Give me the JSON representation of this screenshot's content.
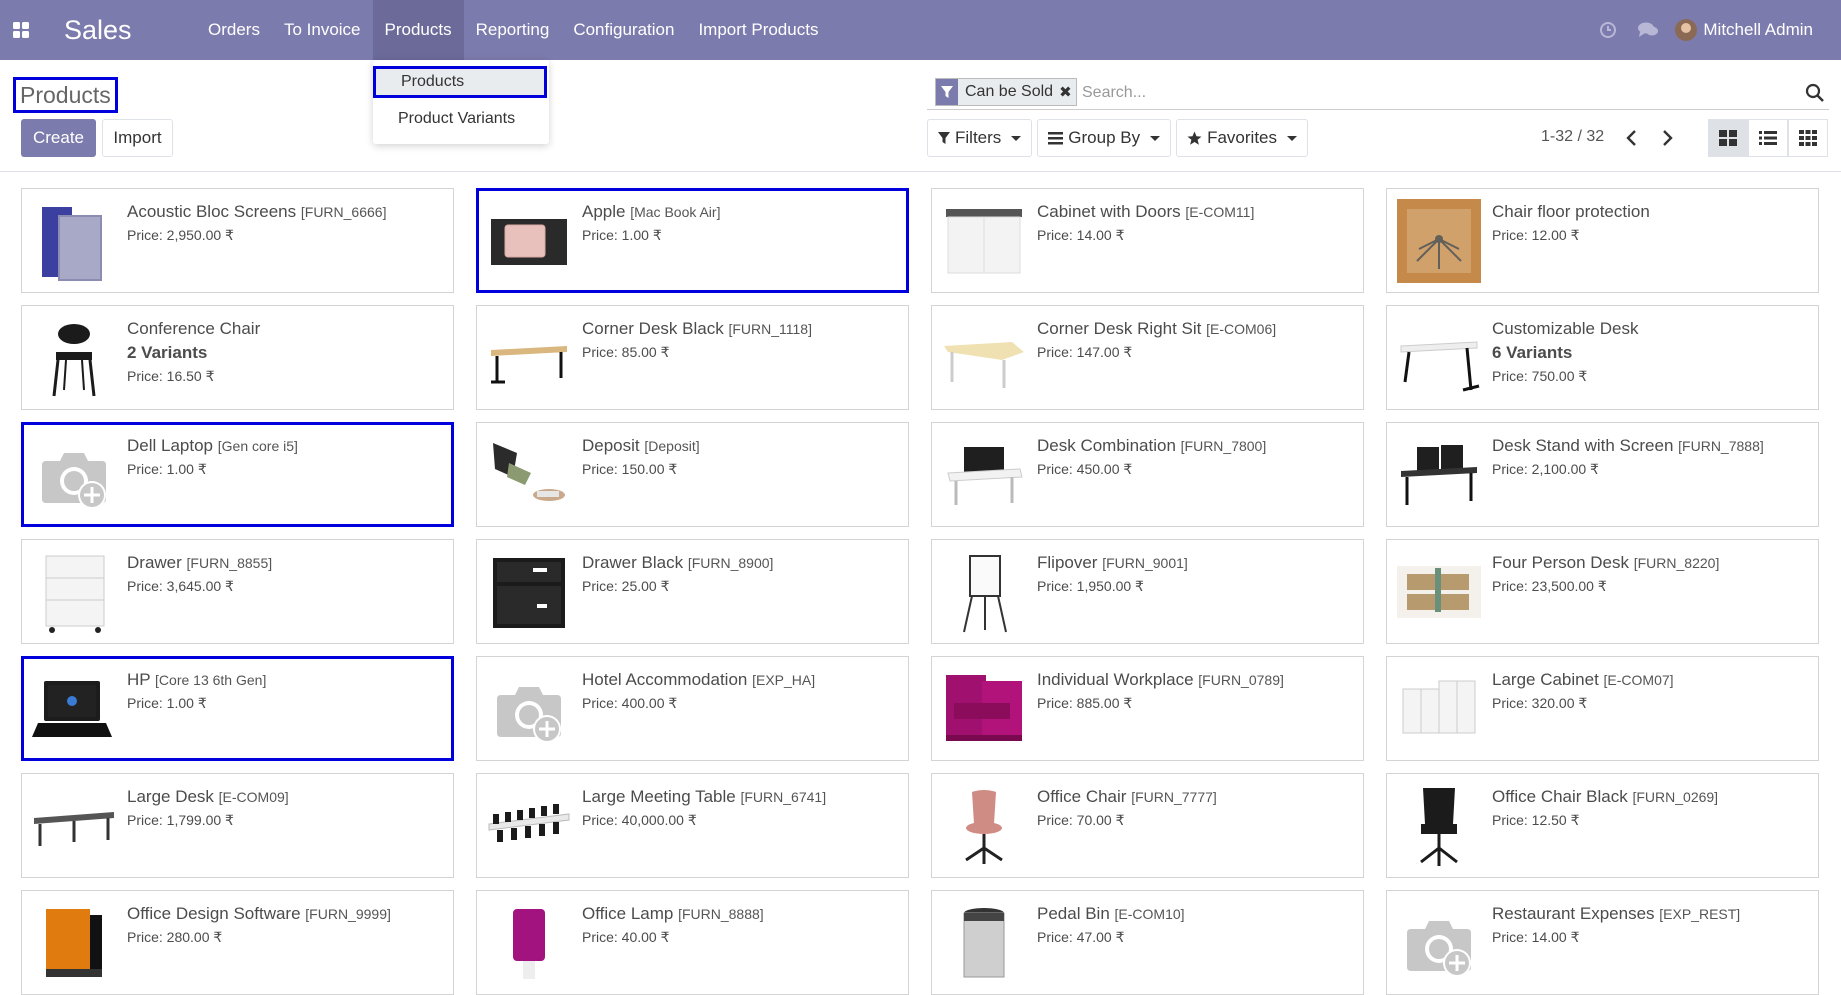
{
  "navbar": {
    "app_name": "Sales",
    "menu": [
      "Orders",
      "To Invoice",
      "Products",
      "Reporting",
      "Configuration",
      "Import Products"
    ],
    "active_menu": "Products",
    "user": "Mitchell Admin",
    "icons": [
      "apps-icon",
      "clock-icon",
      "chat-icon"
    ],
    "color": "#7c7bad"
  },
  "dropdown": {
    "items": [
      "Products",
      "Product Variants"
    ],
    "selected": "Products"
  },
  "control_panel": {
    "title": "Products",
    "create_label": "Create",
    "import_label": "Import",
    "facet": "Can be Sold",
    "search_placeholder": "Search...",
    "filters_label": "Filters",
    "groupby_label": "Group By",
    "favorites_label": "Favorites",
    "pager": "1-32 / 32"
  },
  "products": [
    {
      "name": "Acoustic Bloc Screens",
      "code": "[FURN_6666]",
      "price": "Price: 2,950.00 ₹",
      "img": "screens"
    },
    {
      "name": "Apple",
      "code": "[Mac Book Air]",
      "price": "Price: 1.00 ₹",
      "img": "laptop-pink",
      "highlight": true
    },
    {
      "name": "Cabinet with Doors",
      "code": "[E-COM11]",
      "price": "Price: 14.00 ₹",
      "img": "cabinet"
    },
    {
      "name": "Chair floor protection",
      "code": "",
      "price": "Price: 12.00 ₹",
      "img": "floor"
    },
    {
      "name": "Conference Chair",
      "code": "",
      "variants": "2 Variants",
      "price": "Price: 16.50 ₹",
      "img": "chair-black"
    },
    {
      "name": "Corner Desk Black",
      "code": "[FURN_1118]",
      "price": "Price: 85.00 ₹",
      "img": "desk"
    },
    {
      "name": "Corner Desk Right Sit",
      "code": "[E-COM06]",
      "price": "Price: 147.00 ₹",
      "img": "desk-light"
    },
    {
      "name": "Customizable Desk",
      "code": "",
      "variants": "6 Variants",
      "price": "Price: 750.00 ₹",
      "img": "desk-white"
    },
    {
      "name": "Dell Laptop",
      "code": "[Gen core i5]",
      "price": "Price: 1.00 ₹",
      "img": "placeholder",
      "highlight": true
    },
    {
      "name": "Deposit",
      "code": "[Deposit]",
      "price": "Price: 150.00 ₹",
      "img": "money"
    },
    {
      "name": "Desk Combination",
      "code": "[FURN_7800]",
      "price": "Price: 450.00 ₹",
      "img": "desk-combo"
    },
    {
      "name": "Desk Stand with Screen",
      "code": "[FURN_7888]",
      "price": "Price: 2,100.00 ₹",
      "img": "desk-screen"
    },
    {
      "name": "Drawer",
      "code": "[FURN_8855]",
      "price": "Price: 3,645.00 ₹",
      "img": "drawer-white"
    },
    {
      "name": "Drawer Black",
      "code": "[FURN_8900]",
      "price": "Price: 25.00 ₹",
      "img": "drawer-black"
    },
    {
      "name": "Flipover",
      "code": "[FURN_9001]",
      "price": "Price: 1,950.00 ₹",
      "img": "flipover"
    },
    {
      "name": "Four Person Desk",
      "code": "[FURN_8220]",
      "price": "Price: 23,500.00 ₹",
      "img": "four-desk"
    },
    {
      "name": "HP",
      "code": "[Core 13 6th Gen]",
      "price": "Price: 1.00 ₹",
      "img": "laptop-black",
      "highlight": true
    },
    {
      "name": "Hotel Accommodation",
      "code": "[EXP_HA]",
      "price": "Price: 400.00 ₹",
      "img": "placeholder"
    },
    {
      "name": "Individual Workplace",
      "code": "[FURN_0789]",
      "price": "Price: 885.00 ₹",
      "img": "workplace"
    },
    {
      "name": "Large Cabinet",
      "code": "[E-COM07]",
      "price": "Price: 320.00 ₹",
      "img": "large-cabinet"
    },
    {
      "name": "Large Desk",
      "code": "[E-COM09]",
      "price": "Price: 1,799.00 ₹",
      "img": "large-desk"
    },
    {
      "name": "Large Meeting Table",
      "code": "[FURN_6741]",
      "price": "Price: 40,000.00 ₹",
      "img": "meeting-table"
    },
    {
      "name": "Office Chair",
      "code": "[FURN_7777]",
      "price": "Price: 70.00 ₹",
      "img": "chair-pink"
    },
    {
      "name": "Office Chair Black",
      "code": "[FURN_0269]",
      "price": "Price: 12.50 ₹",
      "img": "chair-office"
    },
    {
      "name": "Office Design Software",
      "code": "[FURN_9999]",
      "price": "Price: 280.00 ₹",
      "img": "software"
    },
    {
      "name": "Office Lamp",
      "code": "[FURN_8888]",
      "price": "Price: 40.00 ₹",
      "img": "lamp"
    },
    {
      "name": "Pedal Bin",
      "code": "[E-COM10]",
      "price": "Price: 47.00 ₹",
      "img": "bin"
    },
    {
      "name": "Restaurant Expenses",
      "code": "[EXP_REST]",
      "price": "Price: 14.00 ₹",
      "img": "placeholder"
    }
  ]
}
